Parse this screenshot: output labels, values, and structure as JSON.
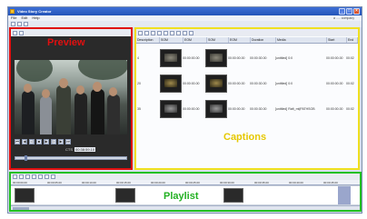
{
  "window": {
    "title": "Video Story Creator"
  },
  "menu": {
    "items": [
      "File",
      "Edit",
      "Help"
    ],
    "brand": "a ..... company"
  },
  "preview": {
    "label": "Preview",
    "time_label": "CTS",
    "time_value": "00:38:59.10"
  },
  "captions": {
    "label": "Captions",
    "columns": [
      "Description",
      "SOM",
      "EOM",
      "SOM",
      "EOM",
      "Duration",
      "Media",
      "Start",
      "End"
    ],
    "rows": [
      {
        "num": "4",
        "som1": "00:00:00.00",
        "som2": "00:00:00.00",
        "duration": "00:00:30.00",
        "media": "[untitled] 0:0",
        "start": "00:00:00.00",
        "end": "00:02"
      },
      {
        "num": "20",
        "som1": "00:00:00.00",
        "som2": "00:00:00.00",
        "duration": "00:00:30.00",
        "media": "[untitled] 0:0",
        "start": "00:00:00.00",
        "end": "00:02"
      },
      {
        "num": "35",
        "som1": "00:00:00.00",
        "som2": "00:00:00.00",
        "duration": "00:00:30.00",
        "media": "[untitled] Raft_mt|PATHSOB",
        "start": "00:00:00.00",
        "end": "00:02"
      }
    ]
  },
  "playlist": {
    "label": "Playlist",
    "ruler": [
      "00:00:00.00",
      "00:00:05.00",
      "00:00:10.00",
      "00:00:15.00",
      "00:00:20.00",
      "00:00:25.00",
      "00:00:30.00",
      "00:00:35.00",
      "00:00:40.00",
      "00:00:45.00"
    ]
  },
  "colors": {
    "preview_border": "#e01010",
    "captions_border": "#f0e020",
    "playlist_border": "#22c022"
  }
}
